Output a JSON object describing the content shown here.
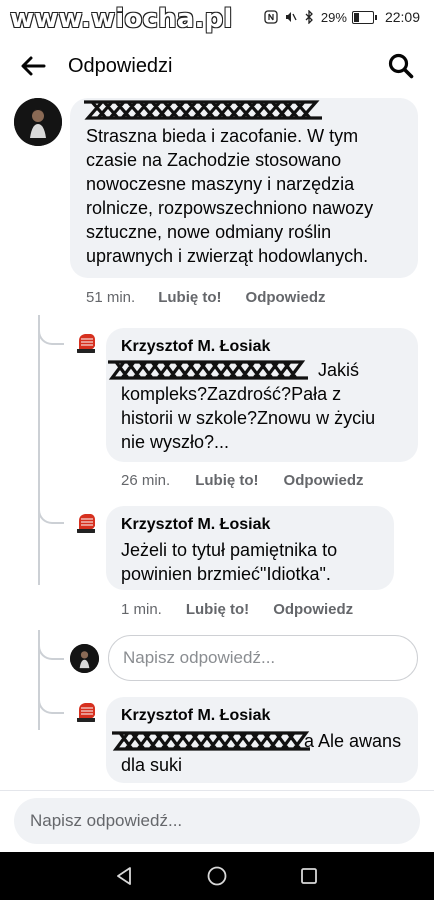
{
  "status": {
    "watermark": "www.wiocha.pl",
    "battery_text": "29%",
    "battery_level": 0.29,
    "time": "22:09"
  },
  "header": {
    "title": "Odpowiedzi"
  },
  "comments": [
    {
      "author": "",
      "text": "Straszna bieda i zacofanie. W tym czasie na Zachodzie stosowano nowoczesne maszyny i narzędzia rolnicze, rozpowszechniono nawozy sztuczne, nowe odmiany roślin uprawnych i zwierząt hodowlanych.",
      "time": "51 min.",
      "like": "Lubię to!",
      "reply": "Odpowiedz"
    },
    {
      "author": "Krzysztof M. Łosiak",
      "text_end": "Jakiś",
      "text": "kompleks?Zazdrość?Pała z historii w szkole?Znowu w życiu nie wyszło?...",
      "time": "26 min.",
      "like": "Lubię to!",
      "reply": "Odpowiedz"
    },
    {
      "author": "Krzysztof M. Łosiak",
      "text": "Jeżeli to tytuł pamiętnika to powinien brzmieć\"Idiotka\".",
      "time": "1 min.",
      "like": "Lubię to!",
      "reply": "Odpowiedz"
    },
    {
      "author": "Krzysztof M. Łosiak",
      "text_end": "a Ale awans",
      "text": "dla suki"
    }
  ],
  "reply_input": {
    "placeholder": "Napisz odpowiedź..."
  },
  "bottom_input": {
    "placeholder": "Napisz odpowiedź..."
  },
  "colors": {
    "bubble": "#f0f2f5",
    "meta": "#65676b",
    "thread_line": "#ccd0d5",
    "avatar_red": "#d6301f"
  }
}
